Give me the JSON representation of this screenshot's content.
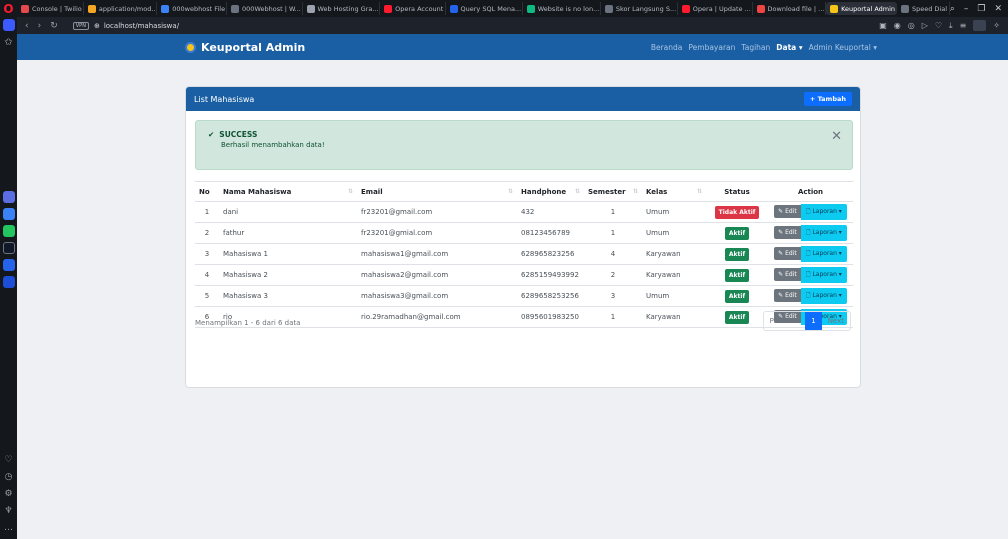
{
  "browser": {
    "tabs": [
      {
        "label": "Console | Twilio",
        "color": "#e5484d"
      },
      {
        "label": "application/mod..",
        "color": "#f5a623"
      },
      {
        "label": "000webhost File",
        "color": "#3b82f6"
      },
      {
        "label": "000Webhost | W...",
        "color": "#6b7280"
      },
      {
        "label": "Web Hosting Gra...",
        "color": "#9ca3af"
      },
      {
        "label": "Opera Account",
        "color": "#ff1b2d"
      },
      {
        "label": "Query SQL Mena...",
        "color": "#2563eb"
      },
      {
        "label": "Website is no lon...",
        "color": "#10b981"
      },
      {
        "label": "Skor Langsung S...",
        "color": "#6b7280"
      },
      {
        "label": "Opera | Update ...",
        "color": "#ff1b2d"
      },
      {
        "label": "Download file | ...",
        "color": "#ef4444"
      },
      {
        "label": "Keuportal Admin",
        "color": "#f5c518"
      },
      {
        "label": "Speed Dial",
        "color": "#6b7280"
      }
    ],
    "url": "localhost/mahasiswa/",
    "vpn": "VPN"
  },
  "navbar": {
    "brand": "Keuportal Admin",
    "menu": [
      "Beranda",
      "Pembayaran",
      "Tagihan",
      "Data ▾",
      "Admin Keuportal ▾"
    ]
  },
  "card": {
    "title": "List Mahasiswa",
    "add_label": "+ Tambah"
  },
  "alert": {
    "title": "SUCCESS",
    "message": "Berhasil menambahkan data!"
  },
  "table": {
    "headers": [
      "No",
      "Nama Mahasiswa",
      "Email",
      "Handphone",
      "Semester",
      "Kelas",
      "Status",
      "Action"
    ],
    "rows": [
      {
        "no": "1",
        "nama": "dani",
        "email": "fr23201@gmail.com",
        "hp": "432",
        "semester": "1",
        "kelas": "Umum",
        "status": "Tidak Aktif"
      },
      {
        "no": "2",
        "nama": "fathur",
        "email": "fr23201@gmial.com",
        "hp": "08123456789",
        "semester": "1",
        "kelas": "Umum",
        "status": "Aktif"
      },
      {
        "no": "3",
        "nama": "Mahasiswa 1",
        "email": "mahasiswa1@gmail.com",
        "hp": "628965823256",
        "semester": "4",
        "kelas": "Karyawan",
        "status": "Aktif"
      },
      {
        "no": "4",
        "nama": "Mahasiswa 2",
        "email": "mahasiswa2@gmail.com",
        "hp": "6285159493992",
        "semester": "2",
        "kelas": "Karyawan",
        "status": "Aktif"
      },
      {
        "no": "5",
        "nama": "Mahasiswa 3",
        "email": "mahasiswa3@gmail.com",
        "hp": "6289658253256",
        "semester": "3",
        "kelas": "Umum",
        "status": "Aktif"
      },
      {
        "no": "6",
        "nama": "rio",
        "email": "rio.29ramadhan@gmail.com",
        "hp": "0895601983250",
        "semester": "1",
        "kelas": "Karyawan",
        "status": "Aktif"
      }
    ],
    "edit_label": "Edit",
    "laporan_label": "Laporan ▾"
  },
  "footer": {
    "info": "Menampilkan 1 - 6 dari 6 data",
    "prev": "Previous",
    "page": "1",
    "next": "Next"
  },
  "colors": {
    "navbar": "#1a5fa3",
    "success_bg": "#d1e7dd",
    "inactive": "#dc3545",
    "active": "#198754",
    "laporan": "#0dcaf0"
  }
}
